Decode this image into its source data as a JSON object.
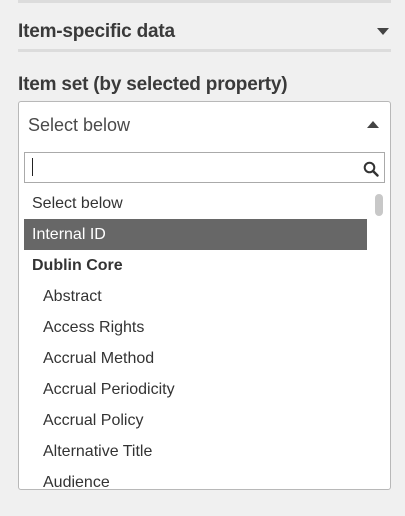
{
  "section": {
    "title": "Item-specific data",
    "toggle_icon": "caret-down-icon"
  },
  "field": {
    "label": "Item set (by selected property)"
  },
  "select": {
    "value": "Select below",
    "arrow_icon": "caret-up-icon",
    "search_value": "",
    "search_icon": "magnifier-icon",
    "highlight_color": "#676767",
    "options": [
      {
        "label": "Select below",
        "kind": "option",
        "indent": false,
        "selected": false
      },
      {
        "label": "Internal ID",
        "kind": "option",
        "indent": false,
        "selected": true
      },
      {
        "label": "Dublin Core",
        "kind": "group",
        "indent": false,
        "selected": false
      },
      {
        "label": "Abstract",
        "kind": "option",
        "indent": true,
        "selected": false
      },
      {
        "label": "Access Rights",
        "kind": "option",
        "indent": true,
        "selected": false
      },
      {
        "label": "Accrual Method",
        "kind": "option",
        "indent": true,
        "selected": false
      },
      {
        "label": "Accrual Periodicity",
        "kind": "option",
        "indent": true,
        "selected": false
      },
      {
        "label": "Accrual Policy",
        "kind": "option",
        "indent": true,
        "selected": false
      },
      {
        "label": "Alternative Title",
        "kind": "option",
        "indent": true,
        "selected": false
      },
      {
        "label": "Audience",
        "kind": "option",
        "indent": true,
        "selected": false
      }
    ]
  }
}
